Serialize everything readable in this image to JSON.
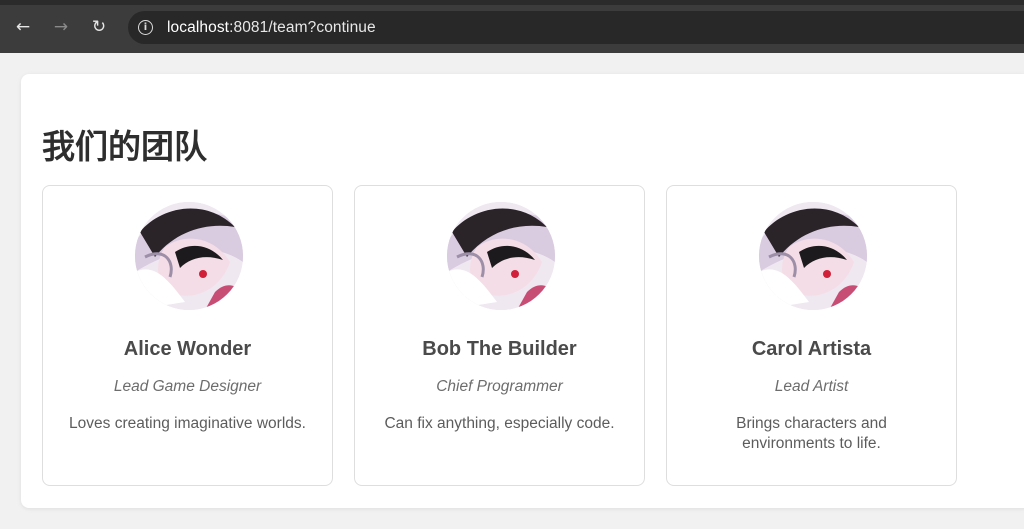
{
  "browser": {
    "back_glyph": "←",
    "forward_glyph": "→",
    "reload_glyph": "↻",
    "url_host": "localhost",
    "url_rest": ":8081/team?continue"
  },
  "page": {
    "title": "我们的团队"
  },
  "team": [
    {
      "name": "Alice Wonder",
      "role": "Lead Game Designer",
      "bio": "Loves creating imaginative worlds."
    },
    {
      "name": "Bob The Builder",
      "role": "Chief Programmer",
      "bio": "Can fix anything, especially code."
    },
    {
      "name": "Carol Artista",
      "role": "Lead Artist",
      "bio": "Brings characters and environments to life."
    }
  ],
  "icons": {
    "back": "arrow-left-icon",
    "forward": "arrow-right-icon",
    "reload": "reload-icon",
    "site_info": "info-icon"
  }
}
